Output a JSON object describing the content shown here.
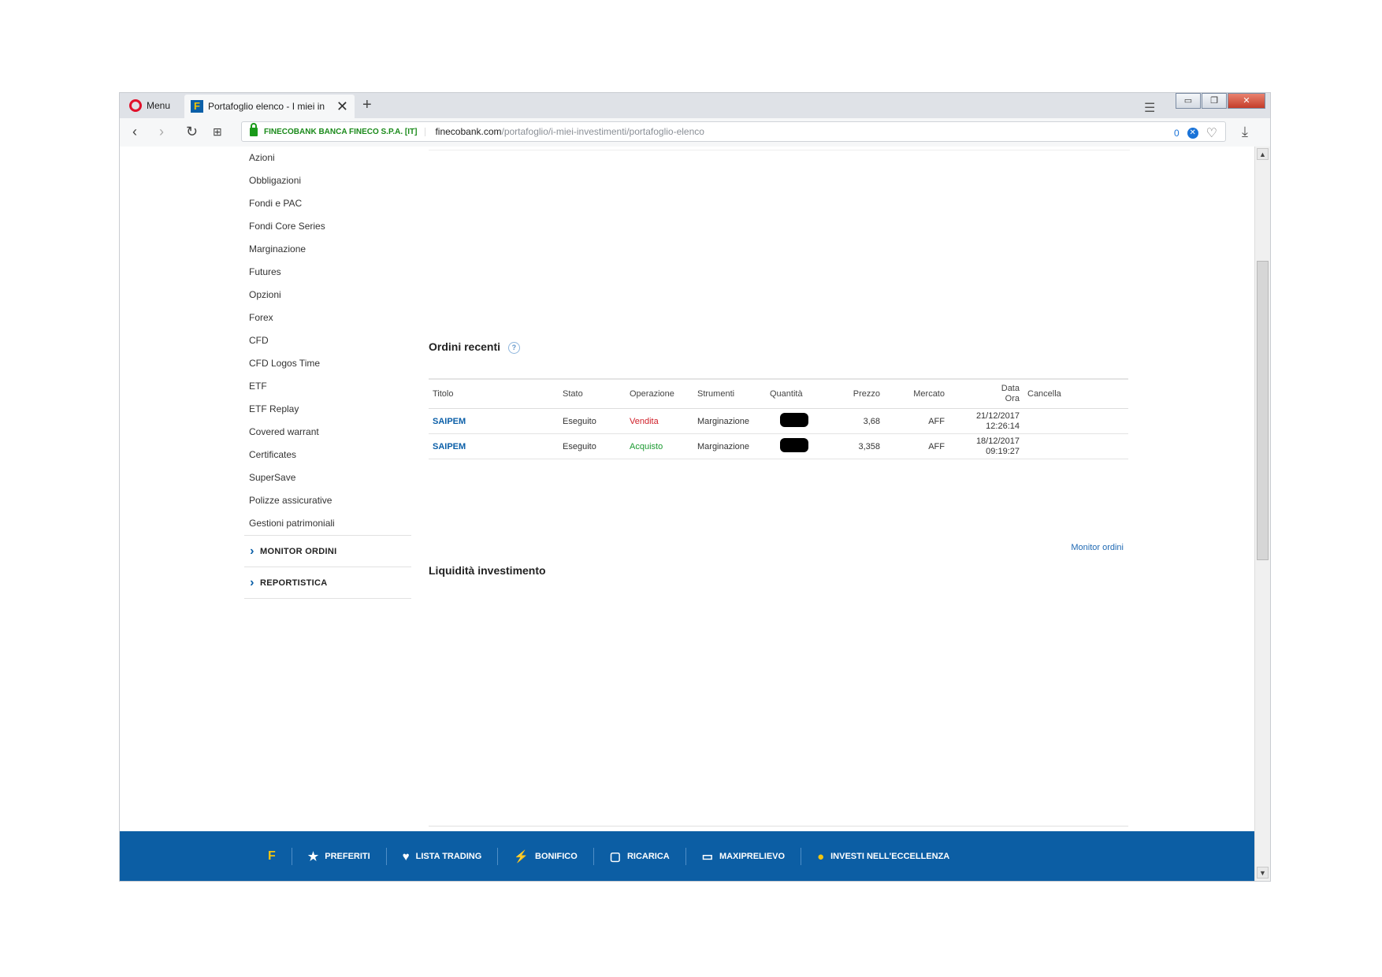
{
  "browser": {
    "menu_label": "Menu",
    "tab_title": "Portafoglio elenco - I miei in",
    "tab_favicon": "F",
    "cert_label": "FINECOBANK BANCA FINECO S.P.A. [IT]",
    "url_host": "finecobank.com",
    "url_path": "/portafoglio/i-miei-investimenti/portafoglio-elenco",
    "adblock_count": "0"
  },
  "sidebar": {
    "items": [
      "Azioni",
      "Obbligazioni",
      "Fondi e PAC",
      "Fondi Core Series",
      "Marginazione",
      "Futures",
      "Opzioni",
      "Forex",
      "CFD",
      "CFD Logos Time",
      "ETF",
      "ETF Replay",
      "Covered warrant",
      "Certificates",
      "SuperSave",
      "Polizze assicurative",
      "Gestioni patrimoniali"
    ],
    "sections": [
      "MONITOR ORDINI",
      "REPORTISTICA"
    ]
  },
  "orders": {
    "title": "Ordini recenti",
    "headers": {
      "titolo": "Titolo",
      "stato": "Stato",
      "operazione": "Operazione",
      "strumenti": "Strumenti",
      "quantita": "Quantità",
      "prezzo": "Prezzo",
      "mercato": "Mercato",
      "data": "Data",
      "ora": "Ora",
      "cancella": "Cancella"
    },
    "rows": [
      {
        "titolo": "SAIPEM",
        "stato": "Eseguito",
        "operazione": "Vendita",
        "strumenti": "Marginazione",
        "prezzo": "3,68",
        "mercato": "AFF",
        "data": "21/12/2017",
        "ora": "12:26:14"
      },
      {
        "titolo": "SAIPEM",
        "stato": "Eseguito",
        "operazione": "Acquisto",
        "strumenti": "Marginazione",
        "prezzo": "3,358",
        "mercato": "AFF",
        "data": "18/12/2017",
        "ora": "09:19:27"
      }
    ],
    "monitor_link": "Monitor ordini"
  },
  "liquidity": {
    "title": "Liquidità investimento"
  },
  "footer": {
    "logo": "F",
    "items": [
      "PREFERITI",
      "LISTA TRADING",
      "BONIFICO",
      "RICARICA",
      "MAXIPRELIEVO",
      "INVESTI NELL'ECCELLENZA"
    ]
  },
  "colors": {
    "brand_blue": "#0c5ea4",
    "sell_red": "#d0202a",
    "buy_green": "#1b9a30",
    "accent_yellow": "#f1c40f"
  }
}
